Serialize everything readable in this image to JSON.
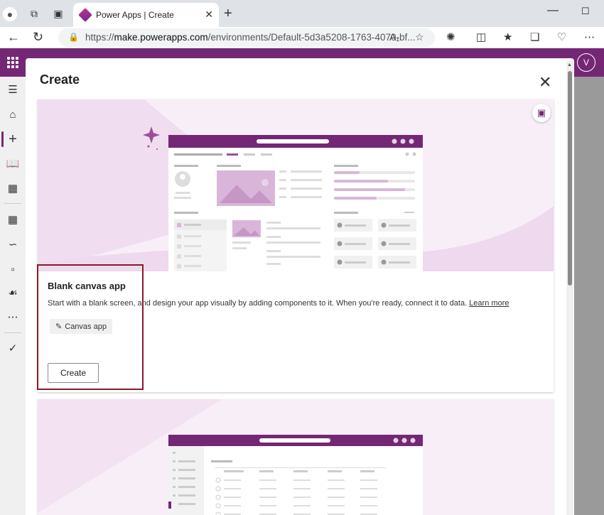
{
  "browser": {
    "tab_title": "Power Apps | Create",
    "url_prefix": "https://",
    "url_host": "make.powerapps.com",
    "url_rest": "/environments/Default-5d3a5208-1763-4070-bf..."
  },
  "app": {
    "avatar_initial": "V"
  },
  "dialog": {
    "title": "Create",
    "card": {
      "title": "Blank canvas app",
      "description": "Start with a blank screen, and design your app visually by adding components to it. When you're ready, connect it to data.",
      "learn_more": "Learn more",
      "tag_label": "Canvas app",
      "create_label": "Create"
    }
  },
  "colors": {
    "brand": "#742774",
    "highlight": "#8b1a2b",
    "hero_bg": "#f8eef8"
  }
}
